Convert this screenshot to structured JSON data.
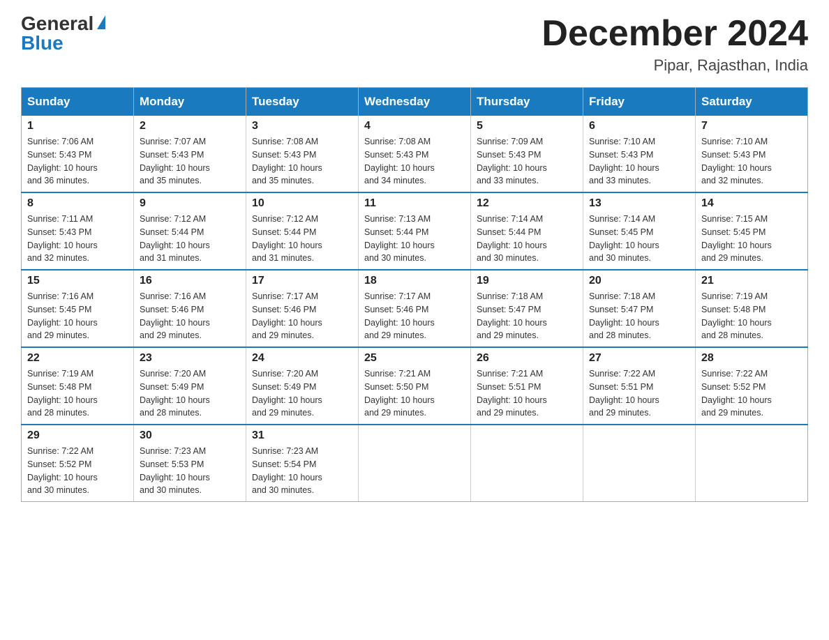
{
  "logo": {
    "general": "General",
    "blue": "Blue"
  },
  "title": "December 2024",
  "location": "Pipar, Rajasthan, India",
  "days_header": [
    "Sunday",
    "Monday",
    "Tuesday",
    "Wednesday",
    "Thursday",
    "Friday",
    "Saturday"
  ],
  "weeks": [
    [
      {
        "day": "1",
        "sunrise": "7:06 AM",
        "sunset": "5:43 PM",
        "daylight": "10 hours and 36 minutes."
      },
      {
        "day": "2",
        "sunrise": "7:07 AM",
        "sunset": "5:43 PM",
        "daylight": "10 hours and 35 minutes."
      },
      {
        "day": "3",
        "sunrise": "7:08 AM",
        "sunset": "5:43 PM",
        "daylight": "10 hours and 35 minutes."
      },
      {
        "day": "4",
        "sunrise": "7:08 AM",
        "sunset": "5:43 PM",
        "daylight": "10 hours and 34 minutes."
      },
      {
        "day": "5",
        "sunrise": "7:09 AM",
        "sunset": "5:43 PM",
        "daylight": "10 hours and 33 minutes."
      },
      {
        "day": "6",
        "sunrise": "7:10 AM",
        "sunset": "5:43 PM",
        "daylight": "10 hours and 33 minutes."
      },
      {
        "day": "7",
        "sunrise": "7:10 AM",
        "sunset": "5:43 PM",
        "daylight": "10 hours and 32 minutes."
      }
    ],
    [
      {
        "day": "8",
        "sunrise": "7:11 AM",
        "sunset": "5:43 PM",
        "daylight": "10 hours and 32 minutes."
      },
      {
        "day": "9",
        "sunrise": "7:12 AM",
        "sunset": "5:44 PM",
        "daylight": "10 hours and 31 minutes."
      },
      {
        "day": "10",
        "sunrise": "7:12 AM",
        "sunset": "5:44 PM",
        "daylight": "10 hours and 31 minutes."
      },
      {
        "day": "11",
        "sunrise": "7:13 AM",
        "sunset": "5:44 PM",
        "daylight": "10 hours and 30 minutes."
      },
      {
        "day": "12",
        "sunrise": "7:14 AM",
        "sunset": "5:44 PM",
        "daylight": "10 hours and 30 minutes."
      },
      {
        "day": "13",
        "sunrise": "7:14 AM",
        "sunset": "5:45 PM",
        "daylight": "10 hours and 30 minutes."
      },
      {
        "day": "14",
        "sunrise": "7:15 AM",
        "sunset": "5:45 PM",
        "daylight": "10 hours and 29 minutes."
      }
    ],
    [
      {
        "day": "15",
        "sunrise": "7:16 AM",
        "sunset": "5:45 PM",
        "daylight": "10 hours and 29 minutes."
      },
      {
        "day": "16",
        "sunrise": "7:16 AM",
        "sunset": "5:46 PM",
        "daylight": "10 hours and 29 minutes."
      },
      {
        "day": "17",
        "sunrise": "7:17 AM",
        "sunset": "5:46 PM",
        "daylight": "10 hours and 29 minutes."
      },
      {
        "day": "18",
        "sunrise": "7:17 AM",
        "sunset": "5:46 PM",
        "daylight": "10 hours and 29 minutes."
      },
      {
        "day": "19",
        "sunrise": "7:18 AM",
        "sunset": "5:47 PM",
        "daylight": "10 hours and 29 minutes."
      },
      {
        "day": "20",
        "sunrise": "7:18 AM",
        "sunset": "5:47 PM",
        "daylight": "10 hours and 28 minutes."
      },
      {
        "day": "21",
        "sunrise": "7:19 AM",
        "sunset": "5:48 PM",
        "daylight": "10 hours and 28 minutes."
      }
    ],
    [
      {
        "day": "22",
        "sunrise": "7:19 AM",
        "sunset": "5:48 PM",
        "daylight": "10 hours and 28 minutes."
      },
      {
        "day": "23",
        "sunrise": "7:20 AM",
        "sunset": "5:49 PM",
        "daylight": "10 hours and 28 minutes."
      },
      {
        "day": "24",
        "sunrise": "7:20 AM",
        "sunset": "5:49 PM",
        "daylight": "10 hours and 29 minutes."
      },
      {
        "day": "25",
        "sunrise": "7:21 AM",
        "sunset": "5:50 PM",
        "daylight": "10 hours and 29 minutes."
      },
      {
        "day": "26",
        "sunrise": "7:21 AM",
        "sunset": "5:51 PM",
        "daylight": "10 hours and 29 minutes."
      },
      {
        "day": "27",
        "sunrise": "7:22 AM",
        "sunset": "5:51 PM",
        "daylight": "10 hours and 29 minutes."
      },
      {
        "day": "28",
        "sunrise": "7:22 AM",
        "sunset": "5:52 PM",
        "daylight": "10 hours and 29 minutes."
      }
    ],
    [
      {
        "day": "29",
        "sunrise": "7:22 AM",
        "sunset": "5:52 PM",
        "daylight": "10 hours and 30 minutes."
      },
      {
        "day": "30",
        "sunrise": "7:23 AM",
        "sunset": "5:53 PM",
        "daylight": "10 hours and 30 minutes."
      },
      {
        "day": "31",
        "sunrise": "7:23 AM",
        "sunset": "5:54 PM",
        "daylight": "10 hours and 30 minutes."
      },
      null,
      null,
      null,
      null
    ]
  ],
  "labels": {
    "sunrise": "Sunrise:",
    "sunset": "Sunset:",
    "daylight": "Daylight:"
  }
}
